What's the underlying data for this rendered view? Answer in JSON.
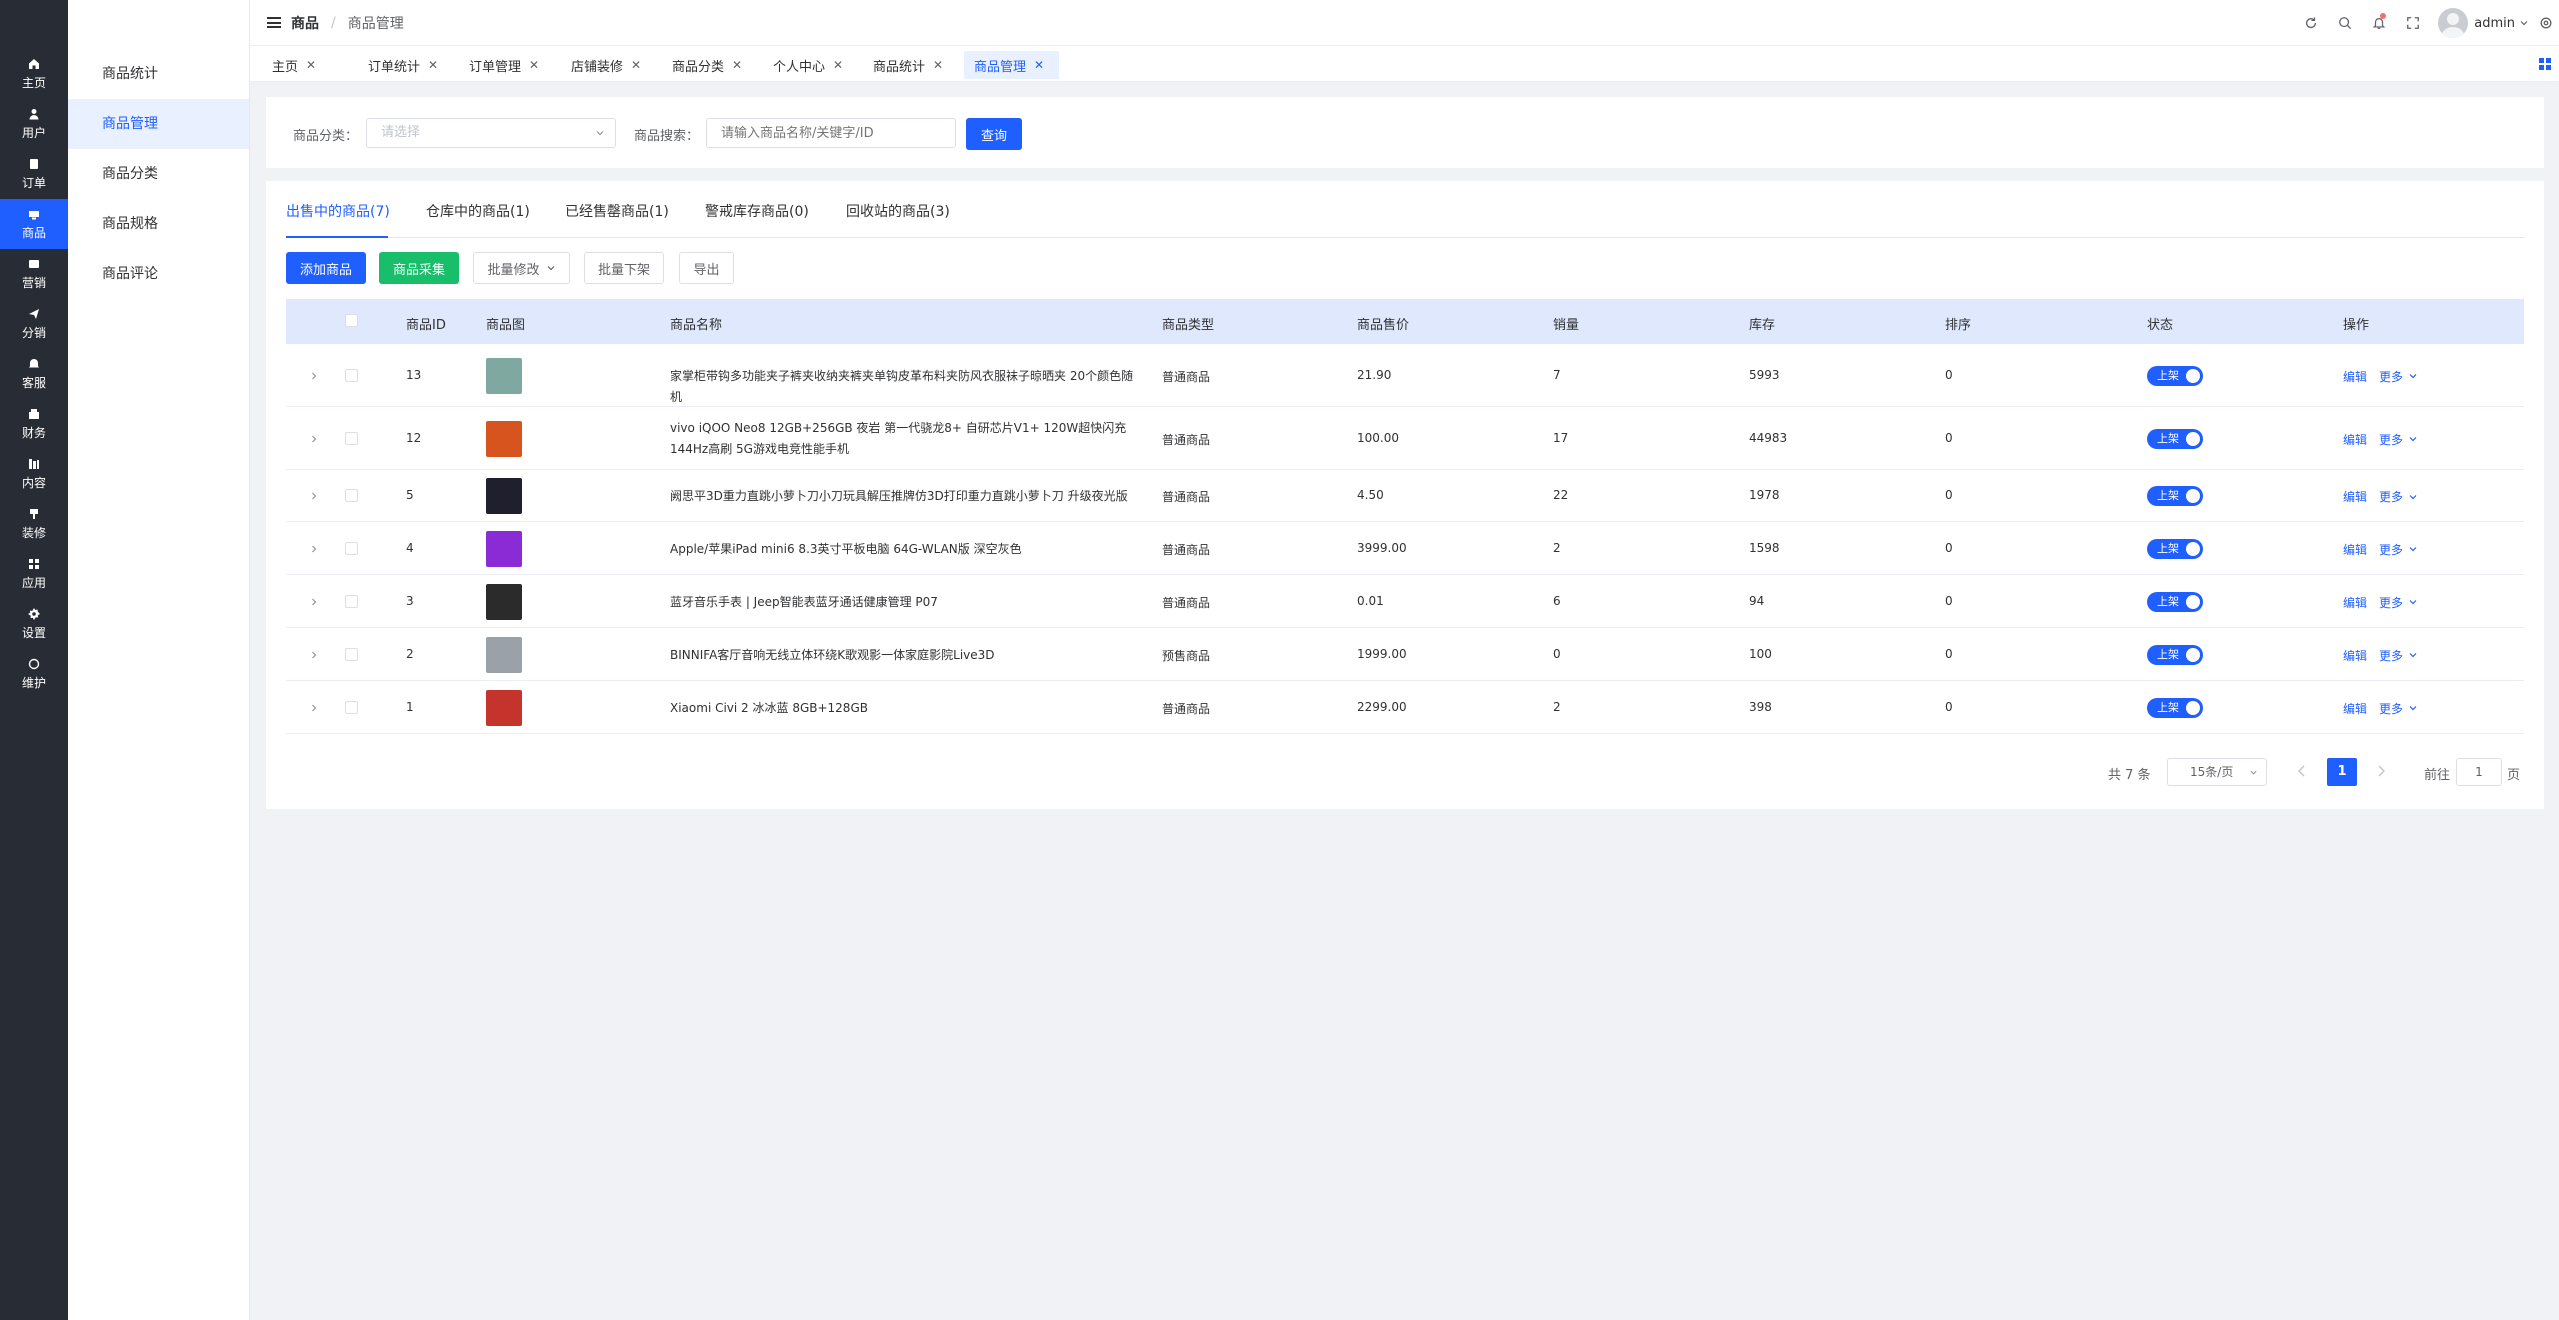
{
  "nav_rail": [
    {
      "label": "主页",
      "icon": "home-icon"
    },
    {
      "label": "用户",
      "icon": "user-icon"
    },
    {
      "label": "订单",
      "icon": "order-icon"
    },
    {
      "label": "商品",
      "icon": "product-icon",
      "active": true
    },
    {
      "label": "营销",
      "icon": "marketing-icon"
    },
    {
      "label": "分销",
      "icon": "distribution-icon"
    },
    {
      "label": "客服",
      "icon": "service-icon"
    },
    {
      "label": "财务",
      "icon": "finance-icon"
    },
    {
      "label": "内容",
      "icon": "content-icon"
    },
    {
      "label": "装修",
      "icon": "decoration-icon"
    },
    {
      "label": "应用",
      "icon": "apps-icon"
    },
    {
      "label": "设置",
      "icon": "settings-icon"
    },
    {
      "label": "维护",
      "icon": "maintenance-icon"
    }
  ],
  "subnav": [
    {
      "label": "商品统计"
    },
    {
      "label": "商品管理",
      "active": true
    },
    {
      "label": "商品分类"
    },
    {
      "label": "商品规格"
    },
    {
      "label": "商品评论"
    }
  ],
  "topbar": {
    "breadcrumb_parent": "商品",
    "breadcrumb_sep": "/",
    "breadcrumb_current": "商品管理",
    "username": "admin"
  },
  "tabs": [
    {
      "label": "主页"
    },
    {
      "label": "订单统计"
    },
    {
      "label": "订单管理"
    },
    {
      "label": "店铺装修"
    },
    {
      "label": "商品分类"
    },
    {
      "label": "个人中心"
    },
    {
      "label": "商品统计"
    },
    {
      "label": "商品管理",
      "active": true
    }
  ],
  "tab_close": "✕",
  "search": {
    "category_label": "商品分类：",
    "category_placeholder": "请选择",
    "keyword_label": "商品搜索：",
    "keyword_placeholder": "请输入商品名称/关键字/ID",
    "query_button": "查询"
  },
  "status_tabs": [
    {
      "label": "出售中的商品(7)",
      "active": true
    },
    {
      "label": "仓库中的商品(1)"
    },
    {
      "label": "已经售罄商品(1)"
    },
    {
      "label": "警戒库存商品(0)"
    },
    {
      "label": "回收站的商品(3)"
    }
  ],
  "actions": {
    "add": "添加商品",
    "collect": "商品采集",
    "batch_edit": "批量修改",
    "batch_offline": "批量下架",
    "export": "导出"
  },
  "table": {
    "columns": [
      "商品ID",
      "商品图",
      "商品名称",
      "商品类型",
      "商品售价",
      "销量",
      "库存",
      "排序",
      "状态",
      "操作"
    ],
    "status_label": "上架",
    "edit_label": "编辑",
    "more_label": "更多",
    "rows": [
      {
        "id": "13",
        "name": "家掌柜带钩多功能夹子裤夹收纳夹裤夹单钩皮革布料夹防风衣服袜子晾晒夹 20个颜色随机",
        "type": "普通商品",
        "price": "21.90",
        "sales": "7",
        "stock": "5993",
        "sort": "0",
        "thumb_color": "#7fa9a0"
      },
      {
        "id": "12",
        "name": "vivo iQOO Neo8 12GB+256GB 夜岩 第一代骁龙8+ 自研芯片V1+ 120W超快闪充 144Hz高刷 5G游戏电竞性能手机",
        "type": "普通商品",
        "price": "100.00",
        "sales": "17",
        "stock": "44983",
        "sort": "0",
        "thumb_color": "#d8541f"
      },
      {
        "id": "5",
        "name": "阙思平3D重力直跳小萝卜刀小刀玩具解压推牌仿3D打印重力直跳小萝卜刀 升级夜光版",
        "type": "普通商品",
        "price": "4.50",
        "sales": "22",
        "stock": "1978",
        "sort": "0",
        "thumb_color": "#1f1f2e"
      },
      {
        "id": "4",
        "name": "Apple/苹果iPad mini6 8.3英寸平板电脑 64G-WLAN版 深空灰色",
        "type": "普通商品",
        "price": "3999.00",
        "sales": "2",
        "stock": "1598",
        "sort": "0",
        "thumb_color": "#8a2bd6"
      },
      {
        "id": "3",
        "name": "蓝牙音乐手表 | Jeep智能表蓝牙通话健康管理 P07",
        "type": "普通商品",
        "price": "0.01",
        "sales": "6",
        "stock": "94",
        "sort": "0",
        "thumb_color": "#2b2b2b"
      },
      {
        "id": "2",
        "name": "BINNIFA客厅音响无线立体环绕K歌观影一体家庭影院Live3D",
        "type": "预售商品",
        "price": "1999.00",
        "sales": "0",
        "stock": "100",
        "sort": "0",
        "thumb_color": "#9aa1a8"
      },
      {
        "id": "1",
        "name": "Xiaomi Civi 2 冰冰蓝 8GB+128GB",
        "type": "普通商品",
        "price": "2299.00",
        "sales": "2",
        "stock": "398",
        "sort": "0",
        "thumb_color": "#c4342d"
      }
    ]
  },
  "pagination": {
    "total": "共 7 条",
    "page_size": "15条/页",
    "current_page": "1",
    "goto_label": "前往",
    "goto_value": "1",
    "page_suffix": "页"
  },
  "colors": {
    "primary": "#1f5eff",
    "success": "#19be6b",
    "sidebar_dark": "#282c34"
  }
}
